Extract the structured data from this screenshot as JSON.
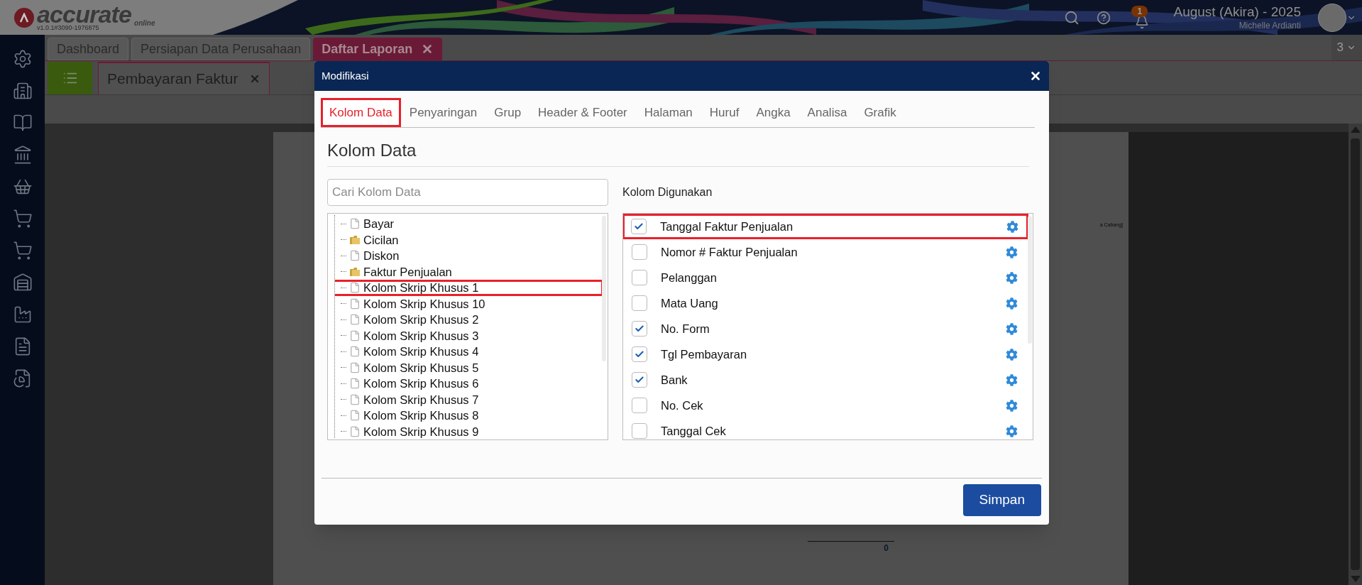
{
  "app": {
    "brand": "accurate",
    "brand_sub": "online",
    "version": "v1.0.1#3090-1976875",
    "notification_count": "1",
    "company": "August (Akira) - 2025",
    "user": "Michelle Ardianti"
  },
  "main_tabs": [
    {
      "label": "Dashboard",
      "selected": false,
      "closable": false
    },
    {
      "label": "Persiapan Data Perusahaan",
      "selected": false,
      "closable": false
    },
    {
      "label": "Daftar Laporan",
      "selected": true,
      "closable": true
    }
  ],
  "tab_count": "3",
  "report_tab": {
    "label": "Pembayaran Faktur"
  },
  "report": {
    "visible_texts": [
      "a Cabang]"
    ],
    "total": "0"
  },
  "dialog": {
    "title": "Modifikasi",
    "tabs": [
      {
        "label": "Kolom Data",
        "selected": true,
        "highlighted": true
      },
      {
        "label": "Penyaringan",
        "selected": false,
        "highlighted": false
      },
      {
        "label": "Grup",
        "selected": false,
        "highlighted": false
      },
      {
        "label": "Header & Footer",
        "selected": false,
        "highlighted": false
      },
      {
        "label": "Halaman",
        "selected": false,
        "highlighted": false
      },
      {
        "label": "Huruf",
        "selected": false,
        "highlighted": false
      },
      {
        "label": "Angka",
        "selected": false,
        "highlighted": false
      },
      {
        "label": "Analisa",
        "selected": false,
        "highlighted": false
      },
      {
        "label": "Grafik",
        "selected": false,
        "highlighted": false
      }
    ],
    "heading": "Kolom Data",
    "search": {
      "placeholder": "Cari Kolom Data"
    },
    "tree": [
      {
        "label": "Bayar",
        "kind": "file",
        "highlighted": false
      },
      {
        "label": "Cicilan",
        "kind": "folder",
        "highlighted": false
      },
      {
        "label": "Diskon",
        "kind": "file",
        "highlighted": false
      },
      {
        "label": "Faktur Penjualan",
        "kind": "folder",
        "highlighted": false
      },
      {
        "label": "Kolom Skrip Khusus 1",
        "kind": "file",
        "highlighted": true
      },
      {
        "label": "Kolom Skrip Khusus 10",
        "kind": "file",
        "highlighted": false
      },
      {
        "label": "Kolom Skrip Khusus 2",
        "kind": "file",
        "highlighted": false
      },
      {
        "label": "Kolom Skrip Khusus 3",
        "kind": "file",
        "highlighted": false
      },
      {
        "label": "Kolom Skrip Khusus 4",
        "kind": "file",
        "highlighted": false
      },
      {
        "label": "Kolom Skrip Khusus 5",
        "kind": "file",
        "highlighted": false
      },
      {
        "label": "Kolom Skrip Khusus 6",
        "kind": "file",
        "highlighted": false
      },
      {
        "label": "Kolom Skrip Khusus 7",
        "kind": "file",
        "highlighted": false
      },
      {
        "label": "Kolom Skrip Khusus 8",
        "kind": "file",
        "highlighted": false
      },
      {
        "label": "Kolom Skrip Khusus 9",
        "kind": "file",
        "highlighted": false
      }
    ],
    "used_heading": "Kolom Digunakan",
    "used_columns": [
      {
        "label": "Tanggal Faktur Penjualan",
        "checked": true,
        "highlighted": true
      },
      {
        "label": "Nomor # Faktur Penjualan",
        "checked": false,
        "highlighted": false
      },
      {
        "label": "Pelanggan",
        "checked": false,
        "highlighted": false
      },
      {
        "label": "Mata Uang",
        "checked": false,
        "highlighted": false
      },
      {
        "label": "No. Form",
        "checked": true,
        "highlighted": false
      },
      {
        "label": "Tgl Pembayaran",
        "checked": true,
        "highlighted": false
      },
      {
        "label": "Bank",
        "checked": true,
        "highlighted": false
      },
      {
        "label": "No. Cek",
        "checked": false,
        "highlighted": false
      },
      {
        "label": "Tanggal Cek",
        "checked": false,
        "highlighted": false
      }
    ],
    "save_button": "Simpan"
  }
}
